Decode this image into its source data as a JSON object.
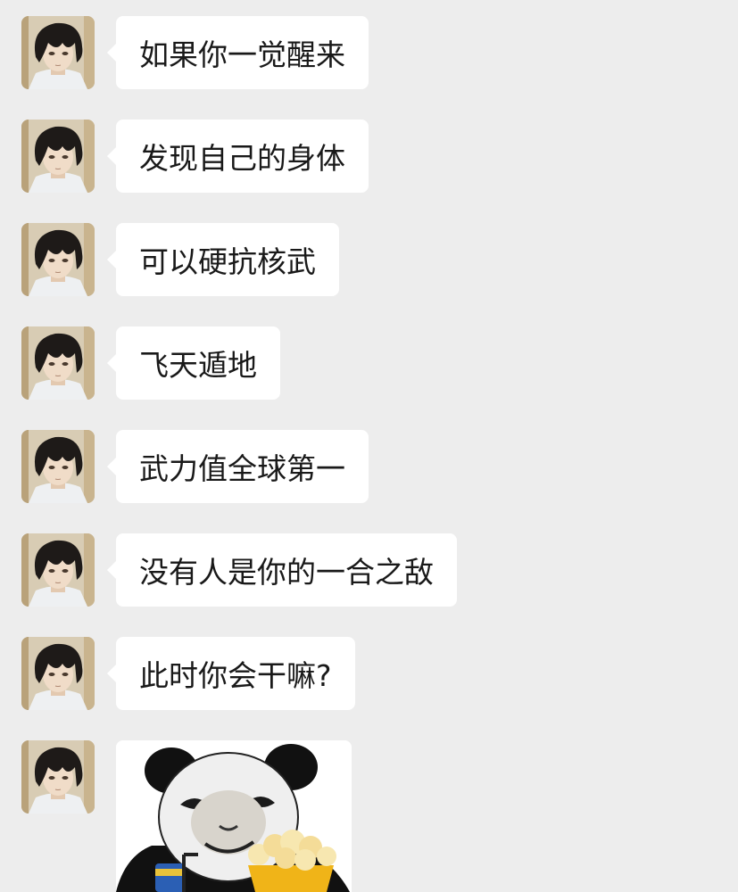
{
  "chat": {
    "messages": [
      {
        "type": "text",
        "text": "如果你一觉醒来"
      },
      {
        "type": "text",
        "text": "发现自己的身体"
      },
      {
        "type": "text",
        "text": "可以硬抗核武"
      },
      {
        "type": "text",
        "text": "飞天遁地"
      },
      {
        "type": "text",
        "text": "武力值全球第一"
      },
      {
        "type": "text",
        "text": "没有人是你的一合之敌"
      },
      {
        "type": "text",
        "text": "此时你会干嘛?"
      },
      {
        "type": "sticker",
        "sticker": "panda-popcorn-sticker"
      }
    ]
  },
  "colors": {
    "background": "#ededed",
    "bubble": "#ffffff",
    "text": "#191919"
  }
}
